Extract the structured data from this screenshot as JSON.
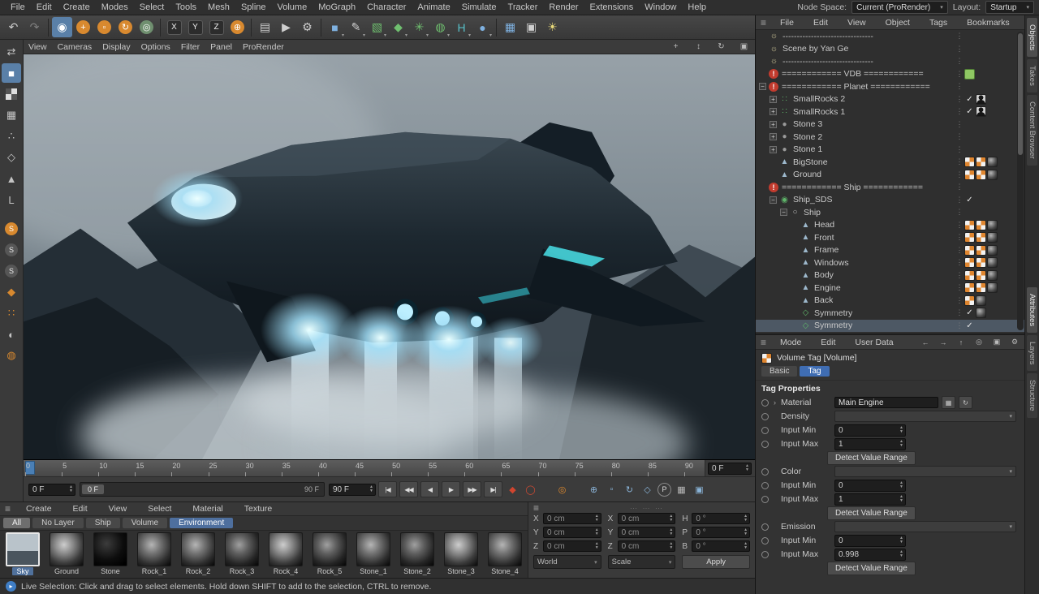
{
  "menubar": {
    "items": [
      "File",
      "Edit",
      "Create",
      "Modes",
      "Select",
      "Tools",
      "Mesh",
      "Spline",
      "Volume",
      "MoGraph",
      "Character",
      "Animate",
      "Simulate",
      "Tracker",
      "Render",
      "Extensions",
      "Window",
      "Help"
    ],
    "node_space_label": "Node Space:",
    "node_space_value": "Current (ProRender)",
    "layout_label": "Layout:",
    "layout_value": "Startup"
  },
  "toolbar": {
    "icons": [
      {
        "name": "undo-icon",
        "glyph": "↶",
        "cls": ""
      },
      {
        "name": "redo-icon",
        "glyph": "↷",
        "cls": "dim"
      },
      {
        "sep": true
      },
      {
        "name": "live-selection-icon",
        "glyph": "◉",
        "cls": "active"
      },
      {
        "name": "move-icon",
        "glyph": "+",
        "cls": "ball"
      },
      {
        "name": "scale-icon",
        "glyph": "▫",
        "cls": "ball"
      },
      {
        "name": "rotate-icon",
        "glyph": "↻",
        "cls": "ball"
      },
      {
        "name": "last-tool-icon",
        "glyph": "◎",
        "cls": "ballg"
      },
      {
        "sep": true
      },
      {
        "name": "x-axis-lock-icon",
        "glyph": "X",
        "cls": "axis"
      },
      {
        "name": "y-axis-lock-icon",
        "glyph": "Y",
        "cls": "axis"
      },
      {
        "name": "z-axis-lock-icon",
        "glyph": "Z",
        "cls": "axis"
      },
      {
        "name": "coordinate-system-icon",
        "glyph": "⊕",
        "cls": "ball"
      },
      {
        "sep": true
      },
      {
        "name": "render-view-icon",
        "glyph": "▤",
        "cls": ""
      },
      {
        "name": "render-picture-viewer-icon",
        "glyph": "▶",
        "cls": ""
      },
      {
        "name": "render-settings-icon",
        "glyph": "⚙",
        "cls": ""
      },
      {
        "sep": true
      },
      {
        "name": "primitive-cube-icon",
        "glyph": "■",
        "cls": "blue dd"
      },
      {
        "name": "spline-pen-icon",
        "glyph": "✎",
        "cls": "dd"
      },
      {
        "name": "generators-icon",
        "glyph": "▧",
        "cls": "green dd"
      },
      {
        "name": "deformers-icon",
        "glyph": "◆",
        "cls": "green dd"
      },
      {
        "name": "mograph-icon",
        "glyph": "✳",
        "cls": "green dd"
      },
      {
        "name": "fields-icon",
        "glyph": "◍",
        "cls": "green dd"
      },
      {
        "name": "hair-icon",
        "glyph": "H",
        "cls": "teal dd"
      },
      {
        "name": "volume-icon",
        "glyph": "●",
        "cls": "blue dd"
      },
      {
        "sep": true
      },
      {
        "name": "team-render-icon",
        "glyph": "▦",
        "cls": "blue"
      },
      {
        "name": "camera-icon",
        "glyph": "▣",
        "cls": ""
      },
      {
        "name": "light-icon",
        "glyph": "☀",
        "cls": "yellow"
      }
    ]
  },
  "leftbar": {
    "icons": [
      {
        "name": "make-editable-icon",
        "glyph": "⇄",
        "cls": ""
      },
      {
        "name": "model-mode-icon",
        "glyph": "■",
        "cls": "active"
      },
      {
        "name": "texture-mode-icon",
        "glyph": "",
        "cls": "checker"
      },
      {
        "name": "workplane-mode-icon",
        "glyph": "▦",
        "cls": ""
      },
      {
        "name": "points-mode-icon",
        "glyph": "∴",
        "cls": ""
      },
      {
        "name": "edges-mode-icon",
        "glyph": "◇",
        "cls": ""
      },
      {
        "name": "polygons-mode-icon",
        "glyph": "▲",
        "cls": ""
      },
      {
        "name": "axis-mode-icon",
        "glyph": "L",
        "cls": ""
      },
      {
        "gap": true
      },
      {
        "name": "snap-enable-icon",
        "glyph": "S",
        "cls": "orangeball"
      },
      {
        "name": "snap-modes-icon",
        "glyph": "S",
        "cls": "darkball"
      },
      {
        "name": "snap-grid-icon",
        "glyph": "S",
        "cls": "darkball"
      },
      {
        "name": "viewport-solo-icon",
        "glyph": "◆",
        "cls": "orange"
      },
      {
        "name": "quantize-icon",
        "glyph": "∷",
        "cls": "orange"
      },
      {
        "name": "material-ball-icon",
        "glyph": "◐",
        "cls": ""
      },
      {
        "name": "torus-icon",
        "glyph": "◍",
        "cls": "orange"
      }
    ]
  },
  "viewport": {
    "menu": [
      "View",
      "Cameras",
      "Display",
      "Options",
      "Filter",
      "Panel",
      "ProRender"
    ],
    "corner_icons": [
      {
        "name": "pan-view-icon",
        "glyph": "+"
      },
      {
        "name": "zoom-view-icon",
        "glyph": "↕"
      },
      {
        "name": "rotate-view-icon",
        "glyph": "↻"
      },
      {
        "name": "maximize-view-icon",
        "glyph": "▣"
      }
    ]
  },
  "timeline": {
    "ticks": [
      "0",
      "5",
      "10",
      "15",
      "20",
      "25",
      "30",
      "35",
      "40",
      "45",
      "50",
      "55",
      "60",
      "65",
      "70",
      "75",
      "80",
      "85",
      "90"
    ],
    "max": 93,
    "current_field": "0 F",
    "start_field": "0 F",
    "slider_handle": "0 F",
    "slider_end": "90 F",
    "end_field": "90 F",
    "transport": [
      {
        "name": "goto-start-button",
        "glyph": "|◀"
      },
      {
        "name": "prev-key-button",
        "glyph": "◀◀"
      },
      {
        "name": "prev-frame-button",
        "glyph": "◀"
      },
      {
        "name": "play-button",
        "glyph": "▶"
      },
      {
        "name": "next-frame-button",
        "glyph": "▶▶"
      },
      {
        "name": "goto-end-button",
        "glyph": "▶|"
      }
    ],
    "record": [
      {
        "name": "record-keyframe-icon",
        "glyph": "◆",
        "cls": "red"
      },
      {
        "name": "autokey-icon",
        "glyph": "◯",
        "cls": "ring"
      },
      {
        "spacer": true
      },
      {
        "name": "keyframe-selection-icon",
        "glyph": "◎",
        "cls": "orange"
      },
      {
        "spacer": true
      },
      {
        "name": "record-position-icon",
        "glyph": "⊕",
        "cls": "blue"
      },
      {
        "name": "record-scale-icon",
        "glyph": "▫",
        "cls": "blue"
      },
      {
        "name": "record-rotation-icon",
        "glyph": "↻",
        "cls": "blue"
      },
      {
        "name": "record-parameter-icon",
        "glyph": "◇",
        "cls": "blue"
      },
      {
        "name": "record-pla-icon",
        "glyph": "P",
        "cls": "circ"
      },
      {
        "name": "solo-grid-icon",
        "glyph": "▦",
        "cls": ""
      },
      {
        "name": "render-monitor-icon",
        "glyph": "▣",
        "cls": "blue"
      }
    ]
  },
  "materials": {
    "menu": [
      "Create",
      "Edit",
      "View",
      "Select",
      "Material",
      "Texture"
    ],
    "tabs": [
      {
        "label": "All",
        "cls": "lt"
      },
      {
        "label": "No Layer",
        "cls": ""
      },
      {
        "label": "Ship",
        "cls": ""
      },
      {
        "label": "Volume",
        "cls": ""
      },
      {
        "label": "Environment",
        "cls": "bluetab"
      }
    ],
    "items": [
      {
        "label": "Sky",
        "thumb": "sky",
        "selected": true
      },
      {
        "label": "Ground",
        "thumb": "rock1"
      },
      {
        "label": "Stone",
        "thumb": "black"
      },
      {
        "label": "Rock_1",
        "thumb": "rock2"
      },
      {
        "label": "Rock_2",
        "thumb": "rock2"
      },
      {
        "label": "Rock_3",
        "thumb": "rock3"
      },
      {
        "label": "Rock_4",
        "thumb": "rock1"
      },
      {
        "label": "Rock_5",
        "thumb": "rock3"
      },
      {
        "label": "Stone_1",
        "thumb": "rock2"
      },
      {
        "label": "Stone_2",
        "thumb": "rock3"
      },
      {
        "label": "Stone_3",
        "thumb": "rock1"
      },
      {
        "label": "Stone_4",
        "thumb": "rock2"
      }
    ]
  },
  "coords": {
    "columns": [
      {
        "fields": [
          {
            "label": "X",
            "value": "0 cm"
          },
          {
            "label": "Y",
            "value": "0 cm"
          },
          {
            "label": "Z",
            "value": "0 cm"
          }
        ],
        "footer": {
          "type": "select",
          "label": "World"
        }
      },
      {
        "fields": [
          {
            "label": "X",
            "value": "0 cm"
          },
          {
            "label": "Y",
            "value": "0 cm"
          },
          {
            "label": "Z",
            "value": "0 cm"
          }
        ],
        "footer": {
          "type": "select",
          "label": "Scale"
        }
      },
      {
        "fields": [
          {
            "label": "H",
            "value": "0 °"
          },
          {
            "label": "P",
            "value": "0 °"
          },
          {
            "label": "B",
            "value": "0 °"
          }
        ],
        "footer": {
          "type": "button",
          "label": "Apply"
        }
      }
    ]
  },
  "object_manager": {
    "menu": [
      "File",
      "Edit",
      "View",
      "Object",
      "Tags",
      "Bookmarks"
    ],
    "right_icons": [
      {
        "name": "search-icon",
        "glyph": "◎"
      },
      {
        "name": "filter-icon",
        "glyph": "▼"
      },
      {
        "name": "lock-icon",
        "glyph": "▣"
      },
      {
        "name": "gear-icon",
        "glyph": "⚙"
      }
    ],
    "rows": [
      {
        "label": "--------------------------------",
        "icon": "lamp",
        "indent": 0,
        "tags": []
      },
      {
        "label": "Scene by Yan Ge",
        "icon": "lamp",
        "indent": 0,
        "tags": []
      },
      {
        "label": "--------------------------------",
        "icon": "lamp",
        "indent": 0,
        "tags": []
      },
      {
        "label": "============ VDB ============",
        "icon": "alert",
        "indent": 0,
        "tags": [
          "note"
        ]
      },
      {
        "label": "============ Planet ============",
        "icon": "alert",
        "indent": 0,
        "exp": "−",
        "tags": []
      },
      {
        "label": "SmallRocks 2",
        "icon": "cloner",
        "indent": 1,
        "exp": "+",
        "tags": [
          "chk",
          "head"
        ]
      },
      {
        "label": "SmallRocks 1",
        "icon": "cloner",
        "indent": 1,
        "exp": "+",
        "tags": [
          "chk",
          "head"
        ]
      },
      {
        "label": "Stone 3",
        "icon": "stone",
        "indent": 1,
        "exp": "+",
        "tags": []
      },
      {
        "label": "Stone 2",
        "icon": "stone",
        "indent": 1,
        "exp": "+",
        "tags": []
      },
      {
        "label": "Stone 1",
        "icon": "stone",
        "indent": 1,
        "exp": "+",
        "tags": []
      },
      {
        "label": "BigStone",
        "icon": "mesh",
        "indent": 1,
        "tags": [
          "mat",
          "mat",
          "ball"
        ]
      },
      {
        "label": "Ground",
        "icon": "mesh",
        "indent": 1,
        "tags": [
          "mat",
          "mat",
          "ball"
        ]
      },
      {
        "label": "============ Ship ============",
        "icon": "alert",
        "indent": 0,
        "tags": []
      },
      {
        "label": "Ship_SDS",
        "icon": "sds",
        "indent": 1,
        "exp": "−",
        "tags": [
          "chk"
        ]
      },
      {
        "label": "Ship",
        "icon": "nullobj",
        "indent": 2,
        "exp": "−",
        "tags": []
      },
      {
        "label": "Head",
        "icon": "mesh",
        "indent": 3,
        "tags": [
          "mat",
          "mat",
          "ball"
        ]
      },
      {
        "label": "Front",
        "icon": "mesh",
        "indent": 3,
        "tags": [
          "mat",
          "mat",
          "ball"
        ]
      },
      {
        "label": "Frame",
        "icon": "mesh",
        "indent": 3,
        "tags": [
          "mat",
          "mat",
          "ball"
        ]
      },
      {
        "label": "Windows",
        "icon": "mesh",
        "indent": 3,
        "tags": [
          "mat",
          "mat",
          "ball"
        ]
      },
      {
        "label": "Body",
        "icon": "mesh",
        "indent": 3,
        "tags": [
          "mat",
          "mat",
          "ball"
        ]
      },
      {
        "label": "Engine",
        "icon": "mesh",
        "indent": 3,
        "tags": [
          "mat",
          "mat",
          "ball"
        ]
      },
      {
        "label": "Back",
        "icon": "mesh",
        "indent": 3,
        "tags": [
          "mat",
          "ball"
        ]
      },
      {
        "label": "Symmetry",
        "icon": "sym",
        "indent": 3,
        "tags": [
          "chk",
          "ball"
        ]
      },
      {
        "label": "Symmetry",
        "icon": "sym",
        "indent": 3,
        "tags": [
          "chk"
        ],
        "selected": true
      }
    ]
  },
  "attributes": {
    "menu": [
      "Mode",
      "Edit",
      "User Data"
    ],
    "right_icons": [
      {
        "name": "history-back-icon",
        "glyph": "←"
      },
      {
        "name": "history-forward-icon",
        "glyph": "→"
      },
      {
        "name": "parent-up-icon",
        "glyph": "↑"
      },
      {
        "name": "find-icon",
        "glyph": "◎"
      },
      {
        "name": "lock-icon",
        "glyph": "▣"
      },
      {
        "name": "gear-icon",
        "glyph": "⚙"
      }
    ],
    "title": "Volume Tag [Volume]",
    "tabs": [
      {
        "label": "Basic",
        "active": false
      },
      {
        "label": "Tag",
        "active": true
      }
    ],
    "section": "Tag Properties",
    "rows": [
      {
        "type": "material",
        "label": "Material",
        "value": "Main Engine"
      },
      {
        "type": "dropdown",
        "label": "Density",
        "value": ""
      },
      {
        "type": "number",
        "label": "Input Min",
        "value": "0"
      },
      {
        "type": "number",
        "label": "Input Max",
        "value": "1"
      },
      {
        "type": "button",
        "label": "Detect Value Range"
      },
      {
        "type": "dropdown",
        "label": "Color",
        "value": ""
      },
      {
        "type": "number",
        "label": "Input Min",
        "value": "0"
      },
      {
        "type": "number",
        "label": "Input Max",
        "value": "1"
      },
      {
        "type": "button",
        "label": "Detect Value Range"
      },
      {
        "type": "dropdown",
        "label": "Emission",
        "value": ""
      },
      {
        "type": "number",
        "label": "Input Min",
        "value": "0"
      },
      {
        "type": "number",
        "label": "Input Max",
        "value": "0.998"
      },
      {
        "type": "button",
        "label": "Detect Value Range"
      }
    ]
  },
  "side_tabs": {
    "top": [
      {
        "label": "Objects",
        "active": true
      },
      {
        "label": "Takes",
        "active": false
      },
      {
        "label": "Content Browser",
        "active": false
      }
    ],
    "bottom": [
      {
        "label": "Attributes",
        "active": true
      },
      {
        "label": "Layers",
        "active": false
      },
      {
        "label": "Structure",
        "active": false
      }
    ]
  },
  "statusbar": {
    "text": "Live Selection: Click and drag to select elements. Hold down SHIFT to add to the selection, CTRL to remove."
  }
}
